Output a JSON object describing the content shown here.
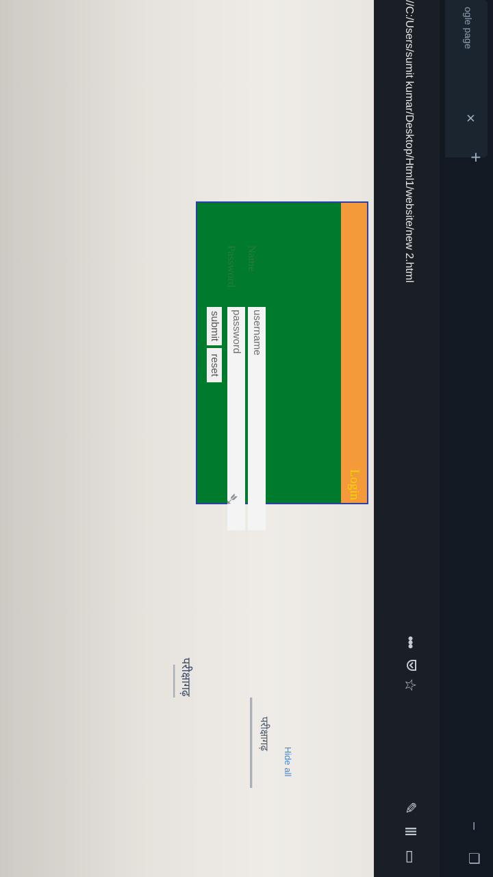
{
  "browser": {
    "tab_title": "ogle page",
    "tab_close": "×",
    "new_tab": "+",
    "url": "//C:/Users/sumit kumar/Desktop/Html1/website/new 2.html",
    "more_menu": "•••",
    "pocket_icon": "pocket-icon",
    "star_icon": "star-icon"
  },
  "login": {
    "title": "Login",
    "name_label": "Name",
    "password_label": "Password",
    "username_placeholder": "username",
    "password_placeholder": "password",
    "submit_label": "submit",
    "reset_label": "reset",
    "colors": {
      "box": "#007a2c",
      "header": "#f49a3b",
      "title": "#f6d20a",
      "border": "#2b3fa8"
    }
  },
  "overlay": {
    "hide_all": "Hide all",
    "brand_small": "परीक्षागढ़",
    "brand_large": "परीक्षागढ़"
  }
}
